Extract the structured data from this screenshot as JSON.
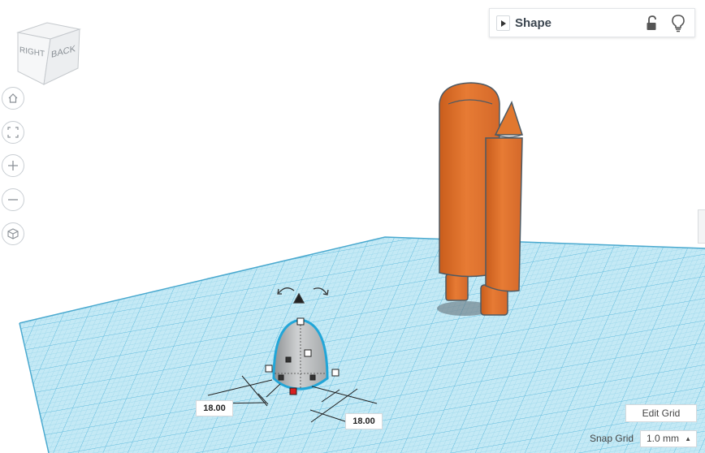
{
  "viewcube": {
    "face_right": "RIGHT",
    "face_back": "BACK"
  },
  "nav": {
    "home_icon": "home-icon",
    "fit_icon": "fit-all-icon",
    "zoom_in_icon": "plus-icon",
    "zoom_out_icon": "minus-icon",
    "view_icon": "perspective-cube-icon"
  },
  "shape_panel": {
    "title": "Shape",
    "lock_icon": "unlock-icon",
    "light_icon": "lightbulb-icon"
  },
  "dimensions": {
    "width": "18.00",
    "depth": "18.00"
  },
  "grid": {
    "edit_label": "Edit Grid",
    "snap_label": "Snap Grid",
    "snap_value": "1.0 mm"
  },
  "colors": {
    "grid": "#bfe5f2",
    "grid_line": "#7cc8e2",
    "orange": "#e67a34",
    "selection": "#1fa7d6",
    "handle_red": "#d8201f"
  }
}
